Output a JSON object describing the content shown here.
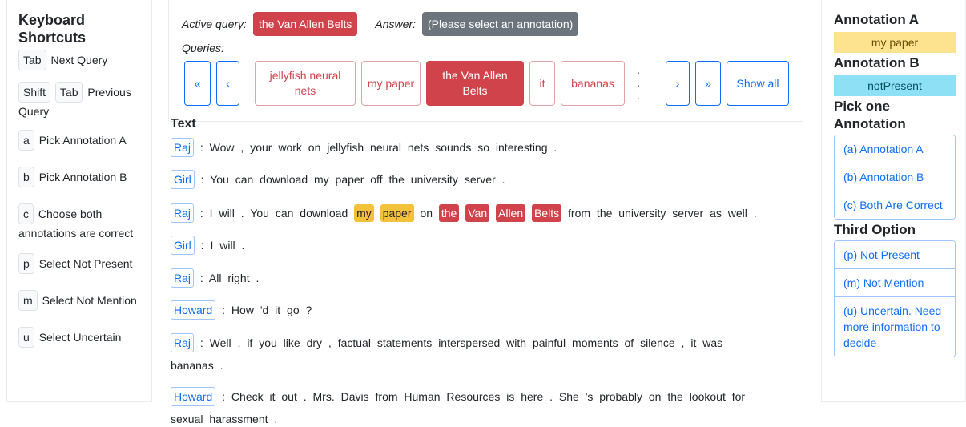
{
  "shortcuts": {
    "title": "Keyboard Shortcuts",
    "items": [
      {
        "keys": [
          "Tab"
        ],
        "label": "Next Query"
      },
      {
        "keys": [
          "Shift",
          "Tab"
        ],
        "label": "Previous Query"
      },
      {
        "keys": [
          "a"
        ],
        "label": "Pick Annotation A"
      },
      {
        "keys": [
          "b"
        ],
        "label": "Pick Annotation B"
      },
      {
        "keys": [
          "c"
        ],
        "label": "Choose both annotations are correct"
      },
      {
        "keys": [
          "p"
        ],
        "label": "Select Not Present"
      },
      {
        "keys": [
          "m"
        ],
        "label": "Select Not Mention"
      },
      {
        "keys": [
          "u"
        ],
        "label": "Select Uncertain"
      }
    ]
  },
  "query": {
    "active_label": "Active query:",
    "active_value": "the Van Allen Belts",
    "answer_label": "Answer:",
    "answer_value": "(Please select an annotation)",
    "queries_label": "Queries:",
    "nav": {
      "first": "«",
      "prev": "‹",
      "next": "›",
      "last": "»",
      "show_all": "Show all",
      "ellipsis": "· · ·"
    },
    "items": [
      "jellyfish neural nets",
      "my paper",
      "the Van Allen Belts",
      "it",
      "bananas"
    ],
    "active_index": 2
  },
  "text": {
    "title": "Text",
    "lines": [
      {
        "speaker": "Raj",
        "text": ": Wow , your work on jellyfish neural nets sounds so interesting ."
      },
      {
        "speaker": "Girl",
        "text": ": You can download my paper off the university server ."
      },
      {
        "speaker": "Raj",
        "pre": ": I will . You can download",
        "y1": "my",
        "y2": "paper",
        "mid": "on",
        "r1": "the",
        "r2": "Van",
        "r3": "Allen",
        "r4": "Belts",
        "post": "from the university server as well ."
      },
      {
        "speaker": "Girl",
        "text": ": I will ."
      },
      {
        "speaker": "Raj",
        "text": ": All right ."
      },
      {
        "speaker": "Howard",
        "text": ": How 'd it go ?"
      },
      {
        "speaker": "Raj",
        "text": ": Well , if you like dry , factual statements interspersed with painful moments of silence , it was",
        "cont": "bananas ."
      },
      {
        "speaker": "Howard",
        "text": ": Check it out . Mrs. Davis from Human Resources is here . She 's probably on the lookout for",
        "cont": "sexual harassment ."
      }
    ]
  },
  "annotations": {
    "a_title": "Annotation A",
    "a_value": "my paper",
    "b_title": "Annotation B",
    "b_value": "notPresent",
    "pick_title": "Pick one Annotation",
    "pick_options": [
      "(a) Annotation A",
      "(b) Annotation B",
      "(c) Both Are Correct"
    ],
    "third_title": "Third Option",
    "third_options": [
      "(p) Not Present",
      "(m) Not Mention",
      "(u) Uncertain. Need more information to decide"
    ],
    "colors": {
      "a": "#fde290",
      "b": "#8ee0f5",
      "highlight_active": "#d1434b"
    }
  }
}
